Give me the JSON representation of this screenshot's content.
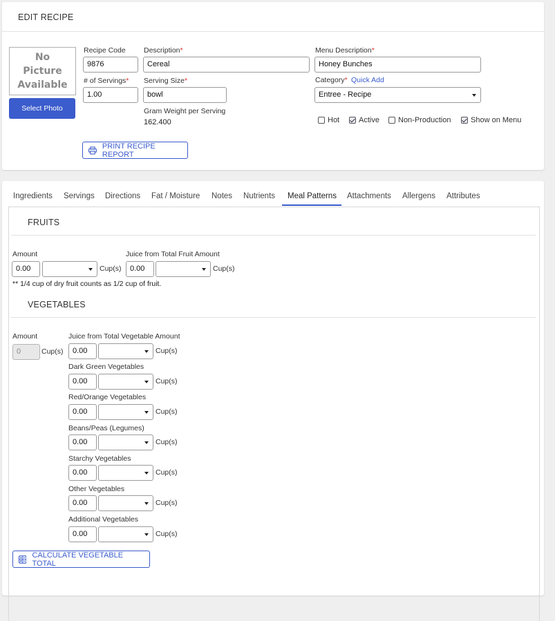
{
  "header": {
    "title": "EDIT RECIPE",
    "no_picture": "No\nPicture\nAvailable",
    "select_photo": "Select Photo",
    "print_report": "PRINT RECIPE REPORT"
  },
  "fields": {
    "recipe_code": {
      "label": "Recipe Code",
      "value": "9876"
    },
    "description": {
      "label": "Description",
      "required": "*",
      "value": "Cereal"
    },
    "menu_description": {
      "label": "Menu Description",
      "required": "*",
      "value": "Honey Bunches"
    },
    "servings": {
      "label": "# of Servings",
      "required": "*",
      "value": "1.00"
    },
    "serving_size": {
      "label": "Serving Size",
      "required": "*",
      "value": "bowl"
    },
    "category": {
      "label": "Category",
      "required": "*",
      "quick_add": "Quick Add",
      "value": "Entree - Recipe"
    },
    "gram_weight": {
      "label": "Gram Weight per Serving",
      "value": "162.400"
    }
  },
  "checkboxes": [
    {
      "label": "Hot",
      "checked": false
    },
    {
      "label": "Active",
      "checked": true
    },
    {
      "label": "Non-Production",
      "checked": false
    },
    {
      "label": "Show on Menu",
      "checked": true
    }
  ],
  "tabs": [
    {
      "label": "Ingredients"
    },
    {
      "label": "Servings"
    },
    {
      "label": "Directions"
    },
    {
      "label": "Fat / Moisture"
    },
    {
      "label": "Notes"
    },
    {
      "label": "Nutrients"
    },
    {
      "label": "Meal Patterns",
      "active": true
    },
    {
      "label": "Attachments"
    },
    {
      "label": "Allergens"
    },
    {
      "label": "Attributes"
    }
  ],
  "fruits": {
    "heading": "FRUITS",
    "amount_label": "Amount",
    "amount_value": "0.00",
    "unit": "Cup(s)",
    "juice_label": "Juice from Total Fruit Amount",
    "juice_value": "0.00",
    "note": "** 1/4 cup of dry fruit counts as 1/2 cup of fruit."
  },
  "vegetables": {
    "heading": "VEGETABLES",
    "amount_label": "Amount",
    "amount_value": "0",
    "unit": "Cup(s)",
    "rows": [
      {
        "label": "Juice from Total Vegetable Amount",
        "value": "0.00"
      },
      {
        "label": "Dark Green Vegetables",
        "value": "0.00"
      },
      {
        "label": "Red/Orange Vegetables",
        "value": "0.00"
      },
      {
        "label": "Beans/Peas (Legumes)",
        "value": "0.00"
      },
      {
        "label": "Starchy Vegetables",
        "value": "0.00"
      },
      {
        "label": "Other Vegetables",
        "value": "0.00"
      },
      {
        "label": "Additional Vegetables",
        "value": "0.00"
      }
    ],
    "calculate_button": "CALCULATE VEGETABLE TOTAL"
  },
  "colors": {
    "accent": "#3b5ccc",
    "required": "#d9342b"
  }
}
